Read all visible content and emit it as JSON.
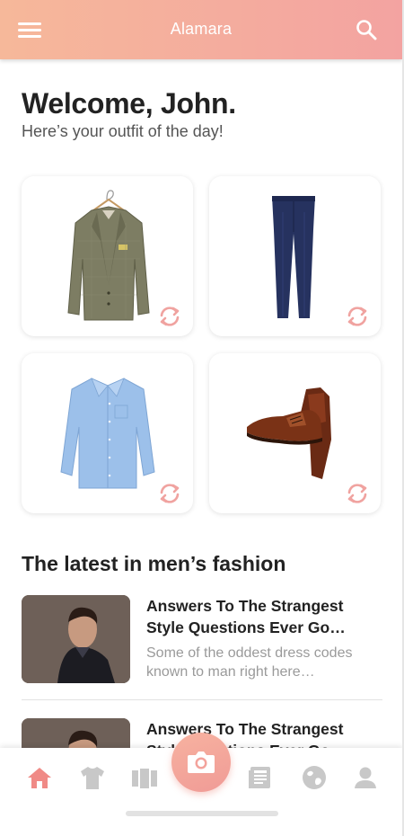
{
  "app": {
    "title": "Alamara",
    "accent_color": "#f3a3a1",
    "accent_gradient_start": "#f6b89a"
  },
  "header": {
    "menu_icon": "menu-icon",
    "search_icon": "search-icon"
  },
  "welcome": {
    "title": "Welcome, John.",
    "subtitle": "Here’s your outfit of the day!"
  },
  "outfit": {
    "items": [
      {
        "name": "blazer",
        "icon": "blazer-image",
        "refresh_icon": "refresh-icon"
      },
      {
        "name": "trousers",
        "icon": "trousers-image",
        "refresh_icon": "refresh-icon"
      },
      {
        "name": "shirt",
        "icon": "shirt-image",
        "refresh_icon": "refresh-icon"
      },
      {
        "name": "shoes",
        "icon": "shoes-image",
        "refresh_icon": "refresh-icon"
      }
    ]
  },
  "fashion": {
    "section_title": "The latest in men’s fashion",
    "articles": [
      {
        "headline": "Answers To The Strangest Style Questions Ever Go…",
        "excerpt": "Some of the oddest dress codes known to man right here…"
      },
      {
        "headline": "Answers To The Strangest Style Questions Ever Go…",
        "excerpt": ""
      }
    ]
  },
  "bottom_nav": {
    "active_color": "#f08a86",
    "inactive_color": "#c8c8c8",
    "items": [
      "home-icon",
      "tshirt-icon",
      "wardrobe-icon",
      "camera-icon",
      "newspaper-icon",
      "globe-icon",
      "profile-icon"
    ],
    "active": "home-icon"
  }
}
